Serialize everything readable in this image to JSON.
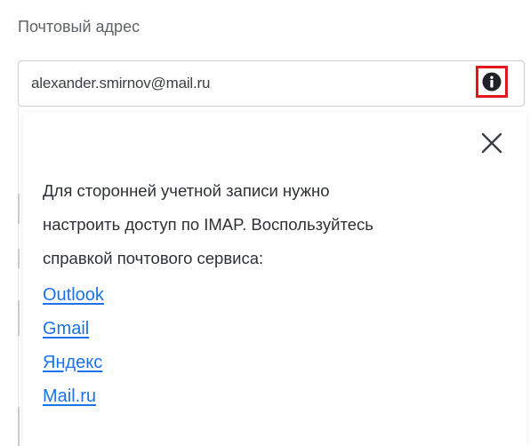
{
  "field": {
    "label": "Почтовый адрес",
    "value": "alexander.smirnov@mail.ru"
  },
  "icons": {
    "info": "info-icon",
    "close": "close-icon"
  },
  "colors": {
    "highlight": "#e0151f",
    "link": "#1a73e8",
    "text": "#2d3135"
  },
  "popup": {
    "message_line1": "Для сторонней учетной записи нужно",
    "message_line2": "настроить доступ по IMAP. Воспользуйтесь",
    "message_line3": "справкой почтового сервиса:",
    "links": [
      "Outlook",
      "Gmail",
      "Яндекс",
      "Mail.ru"
    ]
  }
}
